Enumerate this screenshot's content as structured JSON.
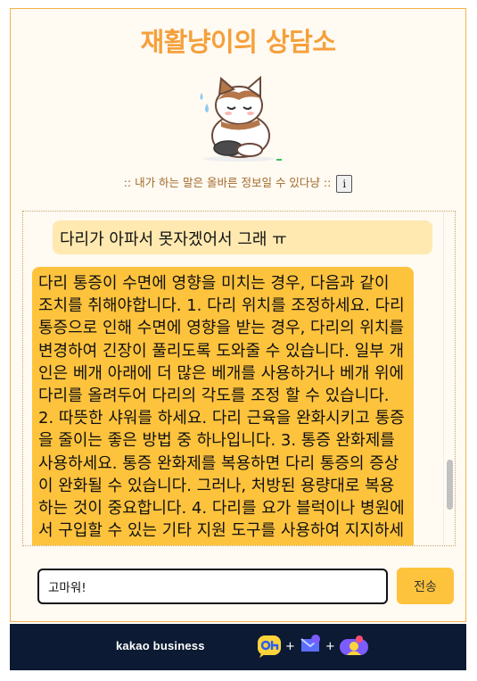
{
  "header": {
    "title": "재활냥이의 상담소",
    "disclaimer": ":: 내가 하는 말은 올바른 정보일 수 있다냥 ::",
    "info_label": "i"
  },
  "chat": {
    "messages": [
      {
        "role": "user",
        "text": "다리가 아파서 못자겠어서 그래 ㅠ"
      },
      {
        "role": "bot",
        "text": "다리 통증이 수면에 영향을 미치는 경우, 다음과 같이 조치를 취해야합니다. 1. 다리 위치를 조정하세요. 다리 통증으로 인해 수면에 영향을 받는 경우, 다리의 위치를 변경하여 긴장이 풀리도록 도와줄 수 있습니다. 일부 개인은 베개 아래에 더 많은 베개를 사용하거나 베개 위에 다리를 올려두어 다리의 각도를 조정 할 수 있습니다. 2. 따뜻한 샤워를 하세요. 다리 근육을 완화시키고 통증을 줄이는 좋은 방법 중 하나입니다. 3. 통증 완화제를 사용하세요. 통증 완화제를 복용하면 다리 통증의 증상이 완화될 수 있습니다. 그러나, 처방된 용량대로 복용하는 것이 중요합니다. 4. 다리를 요가 블럭이나 병원에서 구입할 수 있는 기타 지원 도구를 사용하여 지지하세요."
      }
    ]
  },
  "composer": {
    "input_value": "고마워!",
    "send_label": "전송"
  },
  "footer": {
    "brand": "kakao business"
  },
  "colors": {
    "accent": "#f5a03b",
    "bot_bubble": "#fec33d",
    "user_bubble": "#ffe9b0",
    "footer_bg": "#0c1a33"
  }
}
